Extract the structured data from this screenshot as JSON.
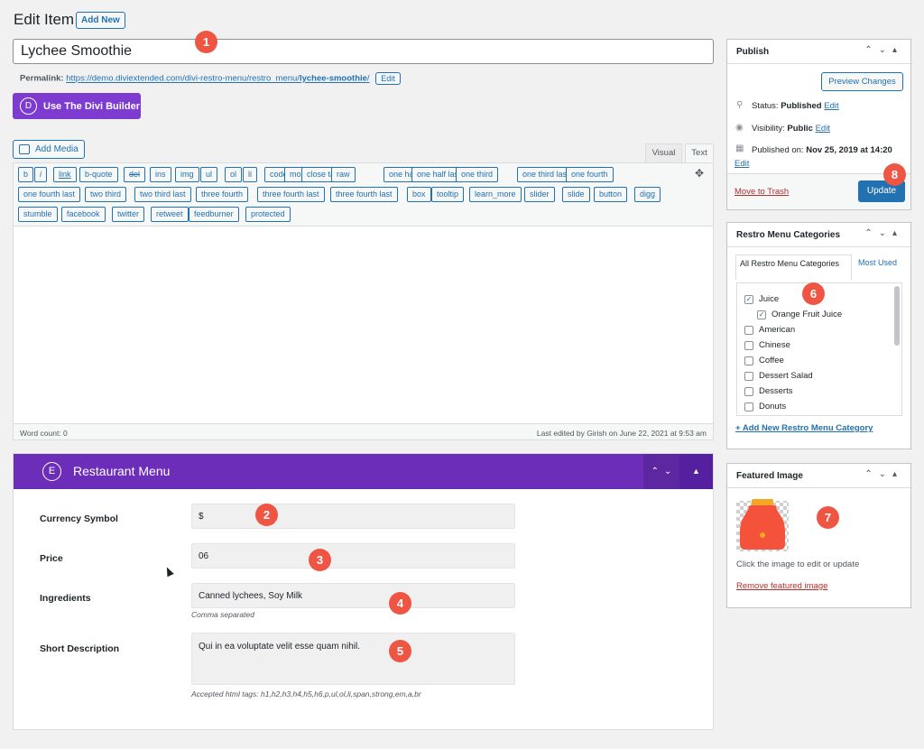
{
  "header": {
    "title": "Edit Item",
    "add_new_label": "Add New"
  },
  "post": {
    "title": "Lychee Smoothie",
    "permalink_label": "Permalink:",
    "permalink_base": "https://demo.diviextended.com/divi-restro-menu/restro_menu/",
    "permalink_slug": "lychee-smoothie",
    "permalink_tail": "/",
    "edit_label": "Edit"
  },
  "divi_button": {
    "icon_letter": "D",
    "label": "Use The Divi Builder"
  },
  "editor": {
    "add_media_label": "Add Media",
    "tab_visual": "Visual",
    "tab_text": "Text",
    "buttons_row1": [
      "b",
      "i",
      "link",
      "b-quote",
      "del",
      "ins",
      "img",
      "ul",
      "ol",
      "li",
      "code",
      "more",
      "close tags",
      "raw",
      "one half",
      "one half last",
      "one third",
      "one third last",
      "one fourth"
    ],
    "buttons_row2": [
      "one fourth last",
      "two third",
      "two third last",
      "three fourth",
      "three fourth last",
      "three fourth last",
      "box",
      "tooltip",
      "learn_more",
      "slider",
      "slide",
      "button",
      "digg"
    ],
    "buttons_row3": [
      "stumble",
      "facebook",
      "twitter",
      "retweet",
      "feedburner",
      "protected"
    ],
    "word_count": "Word count: 0",
    "last_edited": "Last edited by Girish on June 22, 2021 at 9:53 am"
  },
  "restaurant_menu": {
    "icon_letter": "E",
    "title": "Restaurant Menu",
    "currency_label": "Currency Symbol",
    "currency_value": "$",
    "price_label": "Price",
    "price_value": "06",
    "ingredients_label": "Ingredients",
    "ingredients_value": "Canned lychees, Soy Milk",
    "ingredients_hint": "Comma separated",
    "short_desc_label": "Short Description",
    "short_desc_value": "Qui in ea voluptate velit esse quam nihil.",
    "short_desc_hint": "Accepted html tags: h1,h2,h3,h4,h5,h6,p,ul,ol,li,span,strong,em,a,br"
  },
  "publish": {
    "title": "Publish",
    "preview_label": "Preview Changes",
    "status_label": "Status:",
    "status_value": "Published",
    "visibility_label": "Visibility:",
    "visibility_value": "Public",
    "published_on_label": "Published on:",
    "published_on_value": "Nov 25, 2019 at 14:20",
    "edit_label": "Edit",
    "trash_label": "Move to Trash",
    "update_label": "Update"
  },
  "categories": {
    "title": "Restro Menu Categories",
    "tab_all": "All Restro Menu Categories",
    "tab_most_used": "Most Used",
    "items": [
      {
        "label": "Juice",
        "checked": true
      },
      {
        "label": "Orange Fruit Juice",
        "checked": true
      },
      {
        "label": "American",
        "checked": false
      },
      {
        "label": "Chinese",
        "checked": false
      },
      {
        "label": "Coffee",
        "checked": false
      },
      {
        "label": "Dessert Salad",
        "checked": false
      },
      {
        "label": "Desserts",
        "checked": false
      },
      {
        "label": "Donuts",
        "checked": false
      }
    ],
    "add_new_label": "+ Add New Restro Menu Category"
  },
  "featured_image": {
    "title": "Featured Image",
    "hint": "Click the image to edit or update",
    "remove_label": "Remove featured image"
  },
  "markers": [
    "1",
    "2",
    "3",
    "4",
    "5",
    "6",
    "7",
    "8"
  ],
  "colors": {
    "accent": "#2271b1",
    "divi_purple": "#7e3bd0",
    "marker_red": "#ee5543",
    "trash_red": "#b32d2e"
  }
}
